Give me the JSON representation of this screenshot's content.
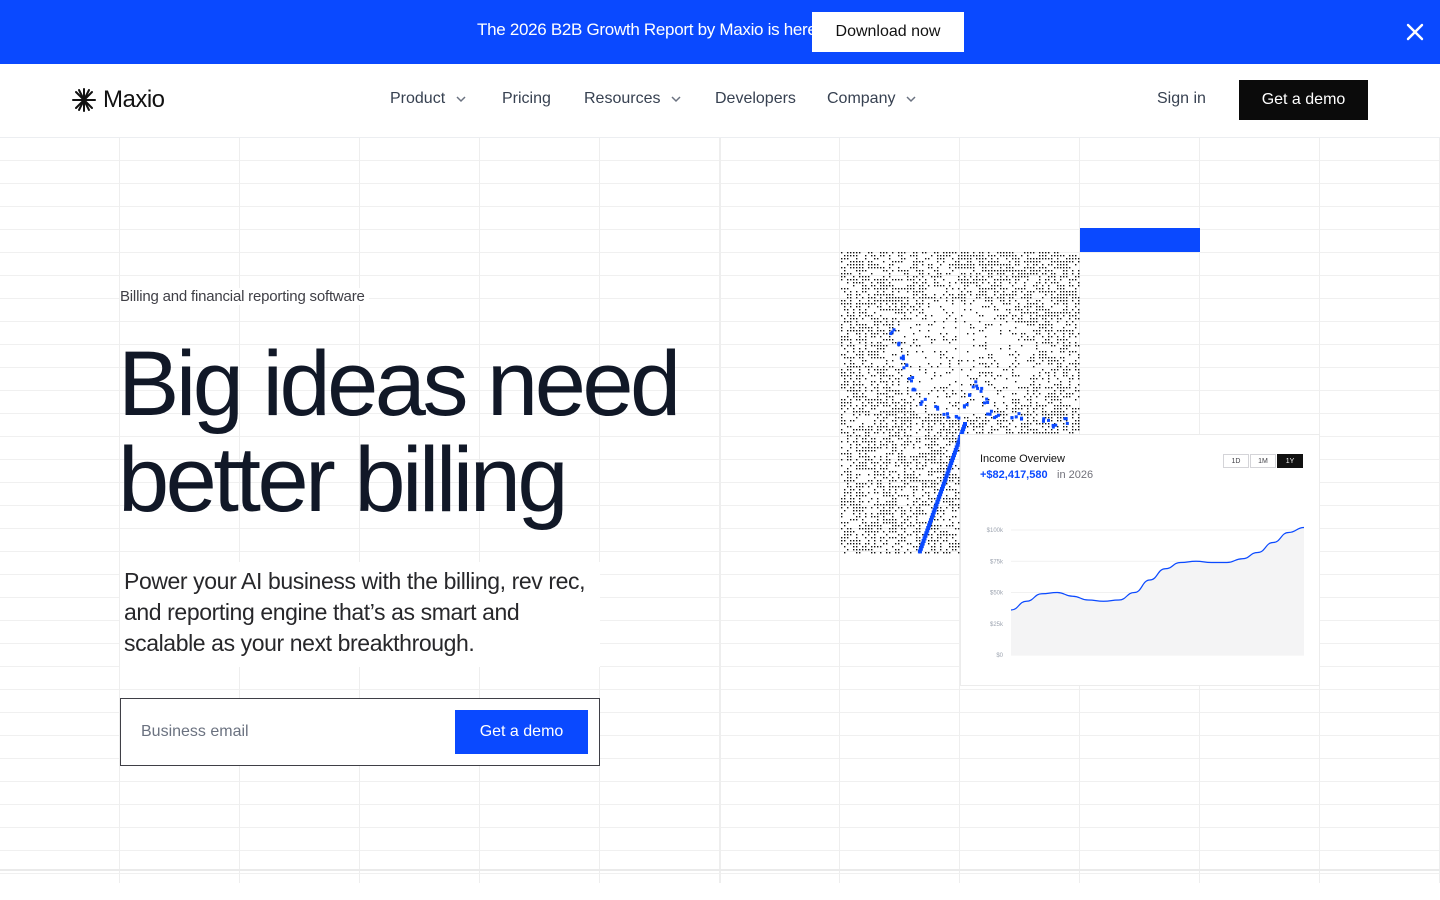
{
  "banner": {
    "text": "The 2026 B2B Growth Report by Maxio is here.",
    "cta_label": "Download now",
    "close_icon": "close-icon",
    "background": "#0a49ff"
  },
  "nav": {
    "brand": "Maxio",
    "items": [
      {
        "label": "Product",
        "has_dropdown": true
      },
      {
        "label": "Pricing",
        "has_dropdown": false
      },
      {
        "label": "Resources",
        "has_dropdown": true
      },
      {
        "label": "Developers",
        "has_dropdown": false
      },
      {
        "label": "Company",
        "has_dropdown": true
      }
    ],
    "signin_label": "Sign in",
    "demo_label": "Get a demo"
  },
  "hero": {
    "eyebrow": "Billing and financial reporting software",
    "title_line1": "Big ideas need",
    "title_line2": "better billing",
    "subtitle": "Power your AI business with the billing, rev rec, and reporting engine that’s as smart and scalable as your next breakthrough.",
    "email_placeholder": "Business email",
    "cta_label": "Get a demo"
  },
  "income_card": {
    "title": "Income Overview",
    "amount": "+$82,417,580",
    "period_text": "in 2026",
    "tabs": [
      "1D",
      "1M",
      "1Y"
    ],
    "active_tab": "1Y",
    "y_ticks": [
      "$100k",
      "$75k",
      "$50k",
      "$25k",
      "$0"
    ],
    "accent_color": "#0a49ff"
  },
  "chart_data": {
    "type": "area",
    "title": "Income Overview",
    "xlabel": "",
    "ylabel": "",
    "ylim": [
      0,
      100000
    ],
    "y_ticks": [
      0,
      25000,
      50000,
      75000,
      100000
    ],
    "y_tick_labels": [
      "$0",
      "$25k",
      "$50k",
      "$75k",
      "$100k"
    ],
    "grid": true,
    "series": [
      {
        "values": [
          36000,
          43000,
          49000,
          50000,
          47000,
          44000,
          43000,
          44000,
          50000,
          60000,
          69000,
          74000,
          75000,
          74000,
          74000,
          77000,
          82000,
          90000,
          98000,
          102000
        ]
      }
    ]
  }
}
